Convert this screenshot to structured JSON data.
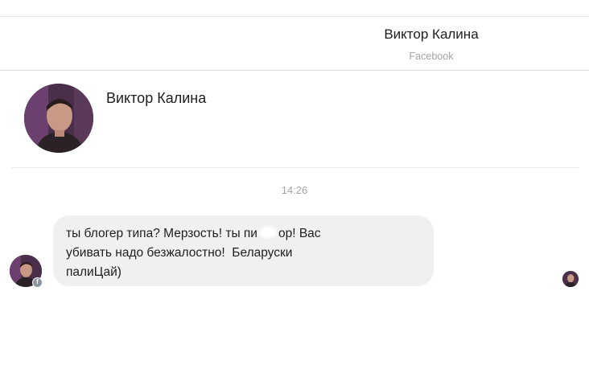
{
  "header": {
    "contact_name": "Виктор Калина",
    "source": "Facebook"
  },
  "profile": {
    "name": "Виктор Калина",
    "avatar_icon": "user-avatar-photo"
  },
  "conversation": {
    "timestamp": "14:26",
    "messages": [
      {
        "sender": "Виктор Калина",
        "lines": [
          "ты блогер типа? Мерзость! ты пи",
          "ор! Вас",
          "убивать надо безжалостно!  Беларуски",
          "палиЦай)"
        ]
      }
    ]
  },
  "colors": {
    "bubble": "#f1f0f0",
    "muted_text": "#a0a3a8",
    "text": "#1c1e21"
  }
}
